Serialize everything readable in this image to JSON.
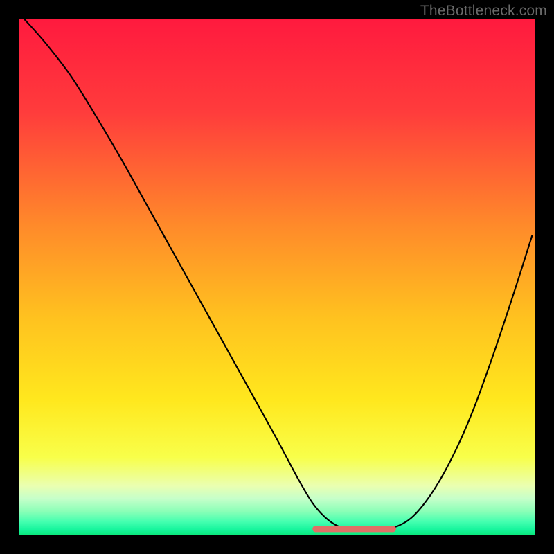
{
  "watermark": "TheBottleneck.com",
  "chart_data": {
    "type": "line",
    "title": "",
    "xlabel": "",
    "ylabel": "",
    "xlim": [
      0,
      100
    ],
    "ylim": [
      0,
      100
    ],
    "background_gradient": {
      "stops": [
        {
          "offset": 0.0,
          "color": "#ff1a3e"
        },
        {
          "offset": 0.18,
          "color": "#ff3c3c"
        },
        {
          "offset": 0.4,
          "color": "#ff8a2a"
        },
        {
          "offset": 0.58,
          "color": "#ffc21f"
        },
        {
          "offset": 0.74,
          "color": "#ffe81e"
        },
        {
          "offset": 0.85,
          "color": "#f8ff4a"
        },
        {
          "offset": 0.905,
          "color": "#eaffb0"
        },
        {
          "offset": 0.93,
          "color": "#c6ffca"
        },
        {
          "offset": 0.955,
          "color": "#8affb7"
        },
        {
          "offset": 0.975,
          "color": "#44ffb0"
        },
        {
          "offset": 0.99,
          "color": "#17f59d"
        },
        {
          "offset": 1.0,
          "color": "#0be87d"
        }
      ]
    },
    "series": [
      {
        "name": "bottleneck-curve",
        "color": "#000000",
        "width": 2.2,
        "x": [
          1.0,
          5,
          10,
          15,
          20,
          25,
          30,
          35,
          40,
          45,
          50,
          54,
          57,
          60,
          63,
          67,
          72,
          76,
          80,
          84,
          88,
          92,
          96,
          99.5
        ],
        "y": [
          100,
          95.5,
          89,
          81,
          72.5,
          63.5,
          54.5,
          45.5,
          36.5,
          27.5,
          18.5,
          11,
          6,
          2.8,
          1.2,
          0.8,
          1.2,
          3.2,
          8,
          15,
          24,
          35,
          47,
          58
        ]
      }
    ],
    "flat_segment": {
      "name": "optimal-range-marker",
      "color": "#e07066",
      "width": 9,
      "x_start": 57.5,
      "x_end": 72.5,
      "y": 1.1,
      "end_radius": 4.5
    }
  }
}
